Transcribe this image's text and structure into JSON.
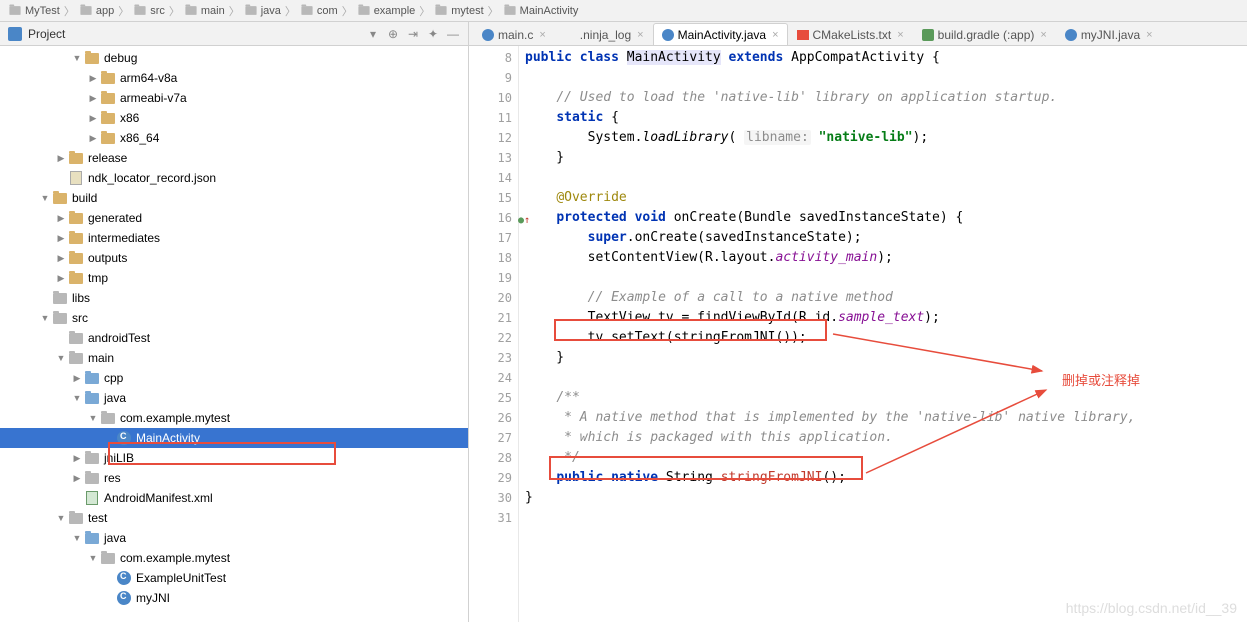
{
  "breadcrumb": [
    "MyTest",
    "app",
    "src",
    "main",
    "java",
    "com",
    "example",
    "mytest",
    "MainActivity"
  ],
  "project": {
    "title": "Project"
  },
  "tree": [
    {
      "indent": 4,
      "arrow": "▼",
      "icon": "folder",
      "label": "debug"
    },
    {
      "indent": 5,
      "arrow": "▶",
      "icon": "folder",
      "label": "arm64-v8a"
    },
    {
      "indent": 5,
      "arrow": "▶",
      "icon": "folder",
      "label": "armeabi-v7a"
    },
    {
      "indent": 5,
      "arrow": "▶",
      "icon": "folder",
      "label": "x86"
    },
    {
      "indent": 5,
      "arrow": "▶",
      "icon": "folder",
      "label": "x86_64"
    },
    {
      "indent": 3,
      "arrow": "▶",
      "icon": "folder",
      "label": "release"
    },
    {
      "indent": 3,
      "arrow": "",
      "icon": "json",
      "label": "ndk_locator_record.json"
    },
    {
      "indent": 2,
      "arrow": "▼",
      "icon": "folder",
      "label": "build"
    },
    {
      "indent": 3,
      "arrow": "▶",
      "icon": "folder",
      "label": "generated"
    },
    {
      "indent": 3,
      "arrow": "▶",
      "icon": "folder",
      "label": "intermediates"
    },
    {
      "indent": 3,
      "arrow": "▶",
      "icon": "folder",
      "label": "outputs"
    },
    {
      "indent": 3,
      "arrow": "▶",
      "icon": "folder",
      "label": "tmp"
    },
    {
      "indent": 2,
      "arrow": "",
      "icon": "folder-gray",
      "label": "libs"
    },
    {
      "indent": 2,
      "arrow": "▼",
      "icon": "folder-gray",
      "label": "src"
    },
    {
      "indent": 3,
      "arrow": "",
      "icon": "folder-gray",
      "label": "androidTest"
    },
    {
      "indent": 3,
      "arrow": "▼",
      "icon": "folder-gray",
      "label": "main"
    },
    {
      "indent": 4,
      "arrow": "▶",
      "icon": "folder-blue",
      "label": "cpp"
    },
    {
      "indent": 4,
      "arrow": "▼",
      "icon": "folder-blue",
      "label": "java"
    },
    {
      "indent": 5,
      "arrow": "▼",
      "icon": "folder-gray",
      "label": "com.example.mytest"
    },
    {
      "indent": 6,
      "arrow": "",
      "icon": "java",
      "label": "MainActivity",
      "selected": true
    },
    {
      "indent": 4,
      "arrow": "▶",
      "icon": "folder-gray",
      "label": "jniLIB"
    },
    {
      "indent": 4,
      "arrow": "▶",
      "icon": "folder-gray",
      "label": "res"
    },
    {
      "indent": 4,
      "arrow": "",
      "icon": "xml",
      "label": "AndroidManifest.xml"
    },
    {
      "indent": 3,
      "arrow": "▼",
      "icon": "folder-gray",
      "label": "test"
    },
    {
      "indent": 4,
      "arrow": "▼",
      "icon": "folder-blue",
      "label": "java"
    },
    {
      "indent": 5,
      "arrow": "▼",
      "icon": "folder-gray",
      "label": "com.example.mytest"
    },
    {
      "indent": 6,
      "arrow": "",
      "icon": "java",
      "label": "ExampleUnitTest"
    },
    {
      "indent": 6,
      "arrow": "",
      "icon": "java",
      "label": "myJNI"
    }
  ],
  "tabs": [
    {
      "icon": "c-blue",
      "label": "main.c",
      "active": false
    },
    {
      "icon": "file",
      "label": ".ninja_log",
      "active": false
    },
    {
      "icon": "c-blue",
      "label": "MainActivity.java",
      "active": true
    },
    {
      "icon": "cmake",
      "label": "CMakeLists.txt",
      "active": false
    },
    {
      "icon": "gradle",
      "label": "build.gradle (:app)",
      "active": false
    },
    {
      "icon": "c-blue",
      "label": "myJNI.java",
      "active": false
    }
  ],
  "code_lines": [
    {
      "n": 8,
      "html": "<span class='kw'>public class </span><span class='hl-bg'>MainActivity</span> <span class='kw'>extends</span> AppCompatActivity {"
    },
    {
      "n": 9,
      "html": ""
    },
    {
      "n": 10,
      "html": "    <span class='cmt'>// Used to load the 'native-lib' library on application startup.</span>"
    },
    {
      "n": 11,
      "html": "    <span class='kw'>static</span> {"
    },
    {
      "n": 12,
      "html": "        System.<span class='static-m'>loadLibrary</span>( <span class='parnm'>libname:</span> <span class='str'>\"native-lib\"</span>);"
    },
    {
      "n": 13,
      "html": "    }"
    },
    {
      "n": 14,
      "html": ""
    },
    {
      "n": 15,
      "html": "    <span class='anno'>@Override</span>"
    },
    {
      "n": 16,
      "html": "    <span class='kw'>protected void</span> onCreate(Bundle savedInstanceState) {",
      "marker": "●↑"
    },
    {
      "n": 17,
      "html": "        <span class='kw'>super</span>.onCreate(savedInstanceState);"
    },
    {
      "n": 18,
      "html": "        setContentView(R.layout.<span class='field'>activity_main</span>);"
    },
    {
      "n": 19,
      "html": ""
    },
    {
      "n": 20,
      "html": "        <span class='cmt'>// Example of a call to a native method</span>"
    },
    {
      "n": 21,
      "html": "        TextView tv = findViewById(R.id.<span class='field'>sample_text</span>);"
    },
    {
      "n": 22,
      "html": "        tv.setText(stringFromJNI());"
    },
    {
      "n": 23,
      "html": "    }"
    },
    {
      "n": 24,
      "html": ""
    },
    {
      "n": 25,
      "html": "    <span class='cmt'>/**</span>"
    },
    {
      "n": 26,
      "html": "<span class='cmt'>     * A native method that is implemented by the 'native-lib' native library,</span>"
    },
    {
      "n": 27,
      "html": "<span class='cmt'>     * which is packaged with this application.</span>"
    },
    {
      "n": 28,
      "html": "<span class='cmt'>     */</span>"
    },
    {
      "n": 29,
      "html": "    <span class='kw'>public native</span> String <span style='color:#c0392b'>stringFromJNI</span>();"
    },
    {
      "n": 30,
      "html": "}"
    },
    {
      "n": 31,
      "html": ""
    }
  ],
  "annotation_text": "删掉或注释掉",
  "watermark": "https://blog.csdn.net/id__39"
}
